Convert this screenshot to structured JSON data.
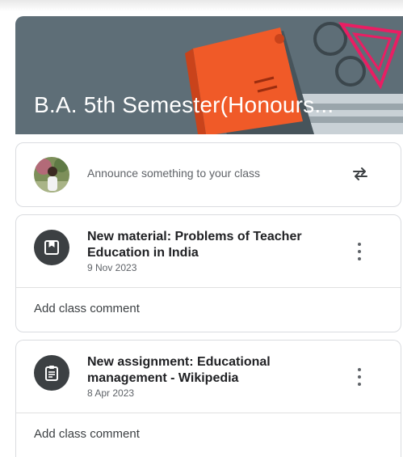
{
  "classroom": {
    "banner_title": "B.A. 5th Semester(Honours..."
  },
  "announce": {
    "placeholder": "Announce something to your class"
  },
  "posts": [
    {
      "icon": "material-icon",
      "title": "New material: Problems of Teacher Education in India",
      "date": "9 Nov 2023",
      "comment_label": "Add class comment"
    },
    {
      "icon": "assignment-icon",
      "title": "New assignment: Educational management - Wikipedia",
      "date": "8 Apr 2023",
      "comment_label": "Add class comment"
    }
  ],
  "colors": {
    "banner": "#5e6e77",
    "book": "#f05a28",
    "accent_pink": "#e91e63"
  }
}
